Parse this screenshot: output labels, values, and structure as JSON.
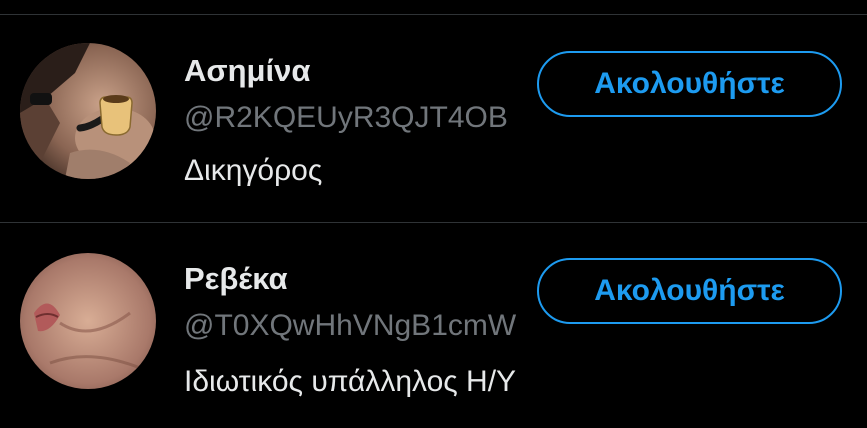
{
  "colors": {
    "background": "#000000",
    "name_text": "#e7e9ea",
    "handle_text": "#71767b",
    "accent": "#1d9bf0",
    "divider": "#2f3336"
  },
  "users": [
    {
      "name": "Ασημίνα",
      "handle": "@R2KQEUyR3QJT4OB",
      "bio": "Δικηγόρος",
      "follow_label": "Ακολουθήστε",
      "avatar_icon": "avatar-image"
    },
    {
      "name": "Ρεβέκα",
      "handle": "@T0XQwHhVNgB1cmW",
      "bio": "Ιδιωτικός υπάλληλος Η/Υ",
      "follow_label": "Ακολουθήστε",
      "avatar_icon": "avatar-image"
    }
  ]
}
